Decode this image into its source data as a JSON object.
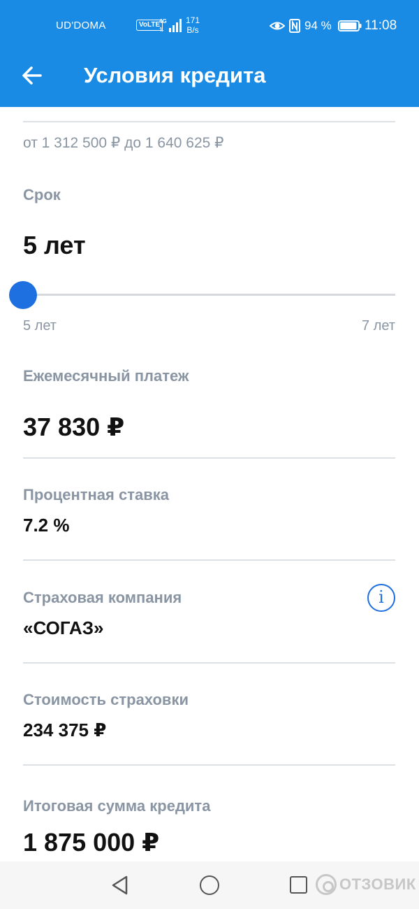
{
  "status_bar": {
    "carrier": "UD'DOMA",
    "volte": "VoLTE",
    "net_speed_value": "171",
    "net_speed_unit": "B/s",
    "battery_percent": "94 %",
    "time": "11:08",
    "battery_level": 0.94
  },
  "app_bar": {
    "title": "Условия кредита"
  },
  "loan": {
    "range_text": "от 1 312 500 ₽ до 1 640 625 ₽",
    "term_label": "Срок",
    "term_value": "5 лет",
    "slider_min": "5 лет",
    "slider_max": "7 лет",
    "slider_position": 0,
    "monthly_label": "Ежемесячный платеж",
    "monthly_value": "37 830 ₽",
    "rate_label": "Процентная ставка",
    "rate_value": "7.2 %",
    "insurer_label": "Страховая компания",
    "insurer_value": "«СОГАЗ»",
    "insurer_info_icon": "i",
    "insurance_cost_label": "Стоимость страховки",
    "insurance_cost_value": "234 375 ₽",
    "total_label": "Итоговая сумма кредита",
    "total_value": "1 875 000 ₽"
  },
  "watermark": {
    "text": "ОТЗОВИК"
  },
  "colors": {
    "app_bar": "#1a8be4",
    "accent": "#1e6fe0",
    "muted_text": "#8a95a3"
  }
}
